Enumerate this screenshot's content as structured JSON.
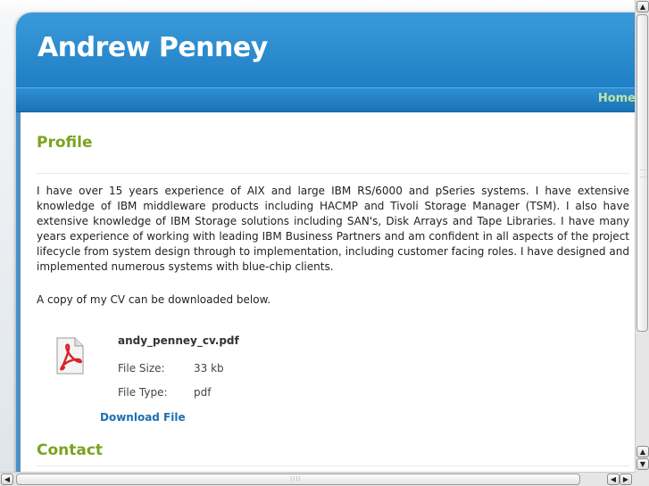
{
  "site": {
    "title": "Andrew Penney"
  },
  "nav": {
    "items": [
      "Home"
    ]
  },
  "profile": {
    "heading": "Profile",
    "body": "I have over 15 years experience of AIX and large IBM RS/6000 and pSeries systems. I have extensive knowledge of IBM middleware products including HACMP and Tivoli Storage Manager (TSM). I also have extensive knowledge of IBM Storage solutions including SAN's, Disk Arrays and Tape Libraries. I have many years experience of working with leading IBM Business Partners and am confident in all aspects of the project lifecycle from system design through to implementation, including customer facing roles. I have designed and implemented numerous systems with blue-chip clients.",
    "cv_note": "A copy of my CV can be downloaded below."
  },
  "file": {
    "icon": "pdf-file-icon",
    "name": "andy_penney_cv.pdf",
    "size_label": "File Size:",
    "size_value": "33 kb",
    "type_label": "File Type:",
    "type_value": "pdf",
    "download_label": "Download File"
  },
  "contact": {
    "heading": "Contact"
  },
  "colors": {
    "header_blue": "#2b8ad0",
    "heading_green": "#7aa320",
    "link_blue": "#1f6fae",
    "nav_text": "#bde6a8"
  },
  "scrollbars": {
    "up_glyph": "▲",
    "down_glyph": "▼",
    "left_glyph": "◀",
    "right_glyph": "▶"
  }
}
